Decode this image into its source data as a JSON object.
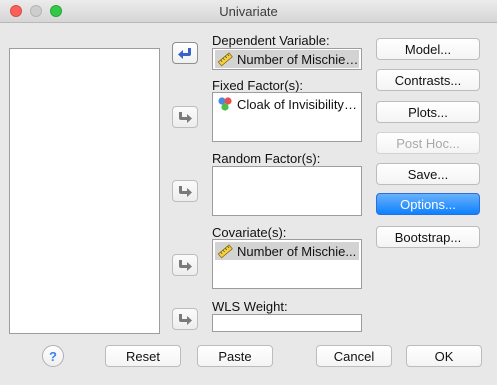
{
  "window": {
    "title": "Univariate"
  },
  "labels": {
    "dependent": "Dependent Variable:",
    "fixed": "Fixed Factor(s):",
    "random": "Random Factor(s):",
    "covariate": "Covariate(s):",
    "wls": "WLS Weight:"
  },
  "fields": {
    "dependent_value": "Number of Mischiev...",
    "fixed_items": [
      "Cloak of Invisibility ..."
    ],
    "covariate_items": [
      "Number of Mischie..."
    ]
  },
  "side_buttons": {
    "model": "Model...",
    "contrasts": "Contrasts...",
    "plots": "Plots...",
    "posthoc": "Post Hoc...",
    "save": "Save...",
    "options": "Options...",
    "bootstrap": "Bootstrap..."
  },
  "bottom_buttons": {
    "help": "?",
    "reset": "Reset",
    "paste": "Paste",
    "cancel": "Cancel",
    "ok": "OK"
  },
  "icons": {
    "dependent_var": "ruler-scale-icon",
    "fixed_var": "nominal-circles-icon",
    "covariate_var": "ruler-scale-icon"
  },
  "colors": {
    "accent_button": "#0d81ff",
    "arrow_active": "#3a5fcd",
    "close": "#fc605b",
    "maximize": "#34c84a"
  }
}
